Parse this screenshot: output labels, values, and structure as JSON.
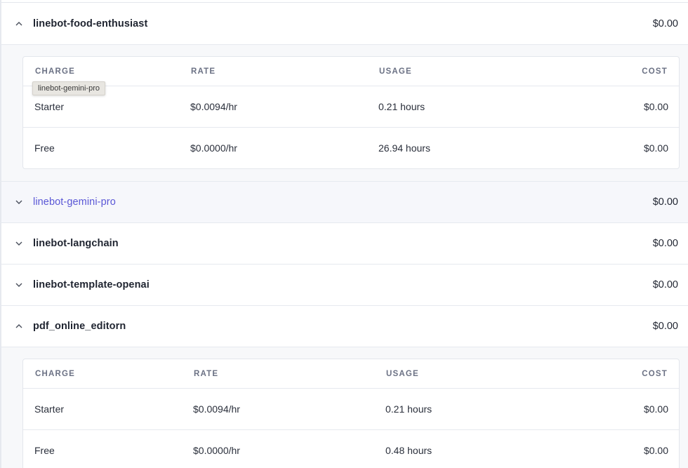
{
  "projects": [
    {
      "name": "linebot-food-enthusiast",
      "amount": "$0.00",
      "expanded": true
    },
    {
      "name": "linebot-gemini-pro",
      "amount": "$0.00",
      "expanded": false
    },
    {
      "name": "linebot-langchain",
      "amount": "$0.00",
      "expanded": false
    },
    {
      "name": "linebot-template-openai",
      "amount": "$0.00",
      "expanded": false
    },
    {
      "name": "pdf_online_editorn",
      "amount": "$0.00",
      "expanded": true
    }
  ],
  "table_headers": {
    "charge": "CHARGE",
    "rate": "RATE",
    "usage": "USAGE",
    "cost": "COST"
  },
  "details": [
    {
      "rows": [
        {
          "charge": "Starter",
          "rate": "$0.0094/hr",
          "usage": "0.21 hours",
          "cost": "$0.00"
        },
        {
          "charge": "Free",
          "rate": "$0.0000/hr",
          "usage": "26.94 hours",
          "cost": "$0.00"
        }
      ]
    },
    {
      "rows": [
        {
          "charge": "Starter",
          "rate": "$0.0094/hr",
          "usage": "0.21 hours",
          "cost": "$0.00"
        },
        {
          "charge": "Free",
          "rate": "$0.0000/hr",
          "usage": "0.48 hours",
          "cost": "$0.00"
        }
      ]
    }
  ],
  "tooltip": "linebot-gemini-pro",
  "colors": {
    "link": "#5a57d6",
    "hover_bg": "#f6f7fb",
    "detail_bg": "#f7f8fa"
  }
}
